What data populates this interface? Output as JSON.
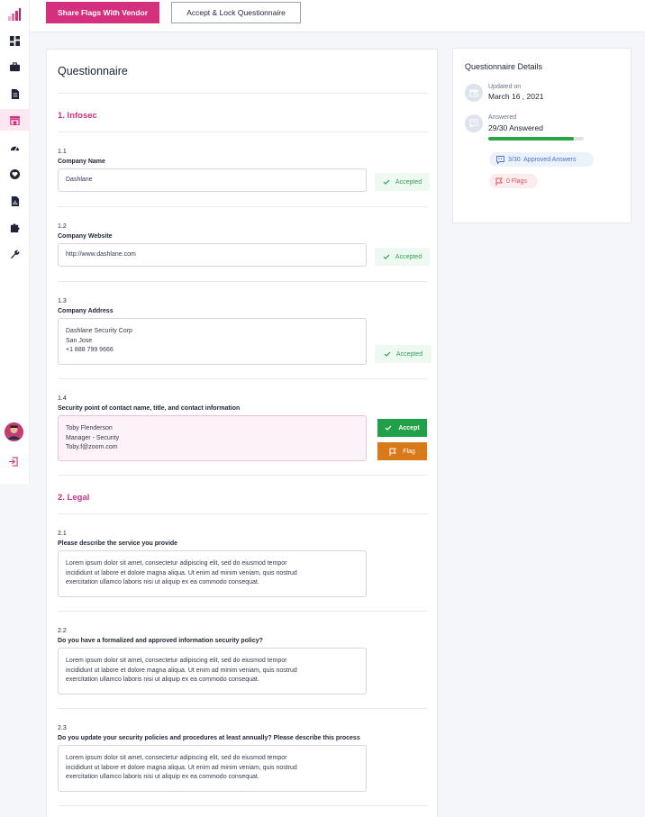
{
  "topbar": {
    "share_button": "Share Flags With Vendor",
    "accept_lock_button": "Accept & Lock Questionnaire"
  },
  "sidebar": {
    "items": [
      {
        "icon": "dashboard-icon"
      },
      {
        "icon": "briefcase-icon"
      },
      {
        "icon": "document-icon"
      },
      {
        "icon": "store-icon",
        "active": true
      },
      {
        "icon": "gauge-icon"
      },
      {
        "icon": "heart-icon"
      },
      {
        "icon": "file-chart-icon"
      },
      {
        "icon": "puzzle-icon"
      },
      {
        "icon": "wrench-icon"
      }
    ],
    "accent_color": "#d4307e"
  },
  "main": {
    "title": "Questionnaire",
    "sections": [
      {
        "title": "1. Infosec",
        "questions": [
          {
            "num": "1.1",
            "label": "Company Name",
            "answer": "Dashlane",
            "status": "Accepted"
          },
          {
            "num": "1.2",
            "label": "Company Website",
            "answer": "http://www.dashlane.com",
            "status": "Accepted"
          },
          {
            "num": "1.3",
            "label": "Company Address",
            "answer": "Dashlane Security Corp\nSan Jose\n+1 888 799 9666",
            "status": "Accepted"
          },
          {
            "num": "1.4",
            "label": "Security point of contact name, title, and contact information",
            "answer": "Toby Flenderson\nManager - Security\nToby.f@zoom.com",
            "accept_label": "Accept",
            "flag_label": "Flag"
          }
        ]
      },
      {
        "title": "2. Legal",
        "questions": [
          {
            "num": "2.1",
            "label": "Please describe the service you provide",
            "answer": "Lorem ipsum dolor sit amet, consectetur adipiscing elit, sed do eiusmod tempor\nincididunt ut labore et dolore magna aliqua. Ut enim ad minim veniam, quis nostrud\nexercitation ullamco laboris nisi ut aliquip ex ea commodo consequat."
          },
          {
            "num": "2.2",
            "label": "Do you have a formalized and approved information security policy?",
            "answer": "Lorem ipsum dolor sit amet, consectetur adipiscing elit, sed do eiusmod tempor\nincididunt ut labore et dolore magna aliqua. Ut enim ad minim veniam, quis nostrud\nexercitation ullamco laboris nisi ut aliquip ex ea commodo consequat."
          },
          {
            "num": "2.3",
            "label": "Do you update your security policies and procedures at least annually? Please describe this process",
            "answer": "Lorem ipsum dolor sit amet, consectetur adipiscing elit, sed do eiusmod tempor\nincididunt ut labore et dolore magna aliqua. Ut enim ad minim veniam, quis nostrud\nexercitation ullamco laboris nisi ut aliquip ex ea commodo consequat."
          }
        ]
      }
    ]
  },
  "details": {
    "title": "Questionnaire Details",
    "updated_label": "Updated on",
    "updated_value": "March 16 , 2021",
    "answered_label": "Answered",
    "answered_value": "29/30 Answered",
    "answered_progress": 0.9,
    "approved_pill": "3/30  Approved Answers",
    "flags_pill": "0 Flags"
  }
}
